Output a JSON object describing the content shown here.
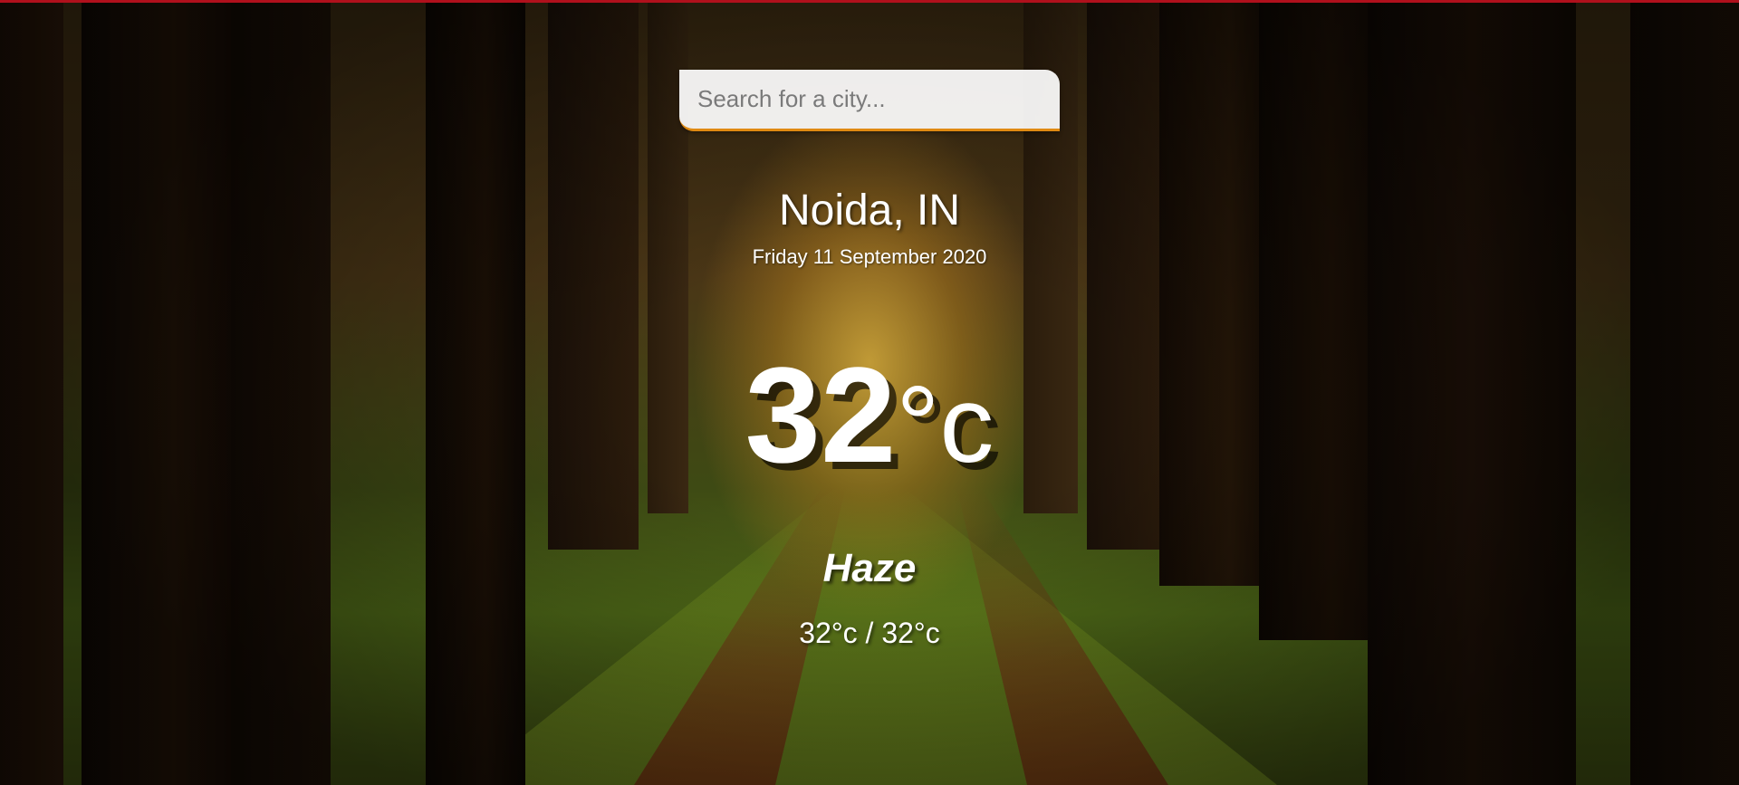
{
  "search": {
    "placeholder": "Search for a city...",
    "value": ""
  },
  "location": {
    "city": "Noida, IN",
    "date": "Friday 11 September 2020"
  },
  "current": {
    "temperature": "32",
    "unit": "°c",
    "condition": "Haze",
    "hi_low": "32°c / 32°c"
  },
  "theme": {
    "accent": "#e08a12",
    "top_border": "#b0101c",
    "text": "#ffffff",
    "background": "forest-path-image"
  }
}
